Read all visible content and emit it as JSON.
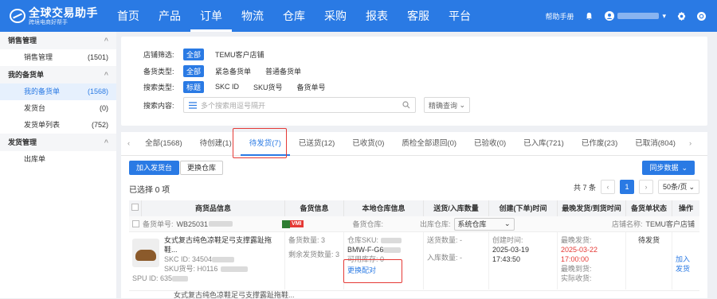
{
  "app": {
    "logo_title": "全球交易助手",
    "logo_sub": "跨境电商好帮手"
  },
  "nav": [
    "首页",
    "产品",
    "订单",
    "物流",
    "仓库",
    "采购",
    "报表",
    "客服",
    "平台"
  ],
  "nav_active": 2,
  "topright": {
    "help": "帮助手册"
  },
  "colors": {
    "primary": "#2a7ae4",
    "alert": "#e53935",
    "vmi_green": "#2e7d32"
  },
  "sidebar": {
    "groups": [
      {
        "label": "销售管理",
        "items": [
          {
            "label": "销售管理",
            "count": "(1501)"
          }
        ]
      },
      {
        "label": "我的备货单",
        "items": [
          {
            "label": "我的备货单",
            "count": "(1568)",
            "active": true
          },
          {
            "label": "发货台",
            "count": "(0)"
          },
          {
            "label": "发货单列表",
            "count": "(752)"
          }
        ]
      },
      {
        "label": "发货管理",
        "items": [
          {
            "label": "出库单",
            "count": ""
          }
        ]
      }
    ]
  },
  "filters": {
    "shop": {
      "label": "店铺筛选:",
      "options": [
        "全部",
        "TEMU客户店铺"
      ]
    },
    "stock_type": {
      "label": "备货类型:",
      "options": [
        "全部",
        "紧急备货单",
        "普通备货单"
      ]
    },
    "search_type": {
      "label": "搜索类型:",
      "options": [
        "标题",
        "SKC ID",
        "SKU货号",
        "备货单号"
      ]
    },
    "search": {
      "label": "搜索内容:",
      "placeholder": "多个搜索用逗号隔开",
      "mode": "精确查询"
    }
  },
  "tabs": [
    "全部(1568)",
    "待创建(1)",
    "待发货(7)",
    "已送货(12)",
    "已收货(0)",
    "质检全部退回(0)",
    "已验收(0)",
    "已入库(721)",
    "已作废(23)",
    "已取消(804)"
  ],
  "tab_active": 2,
  "actions": {
    "add_to_shipping": "加入发货台",
    "change_warehouse": "更换仓库",
    "sync": "同步数据"
  },
  "selection": "已选择 0 项",
  "pager": {
    "total": "共 7 条",
    "current": "1",
    "per_page": "50条/页"
  },
  "columns": [
    "商货品信息",
    "备货信息",
    "本地仓库信息",
    "送货/入库数量",
    "创建(下单)时间",
    "最晚发货/到货时间",
    "备货单状态",
    "操作"
  ],
  "order": {
    "order_no_label": "备货单号:",
    "order_no": "WB25031",
    "badge": "VMI",
    "warehouse_label": "备货仓库:",
    "outbound_label": "出库仓库:",
    "outbound_value": "系统仓库",
    "shop_label": "店铺名称:",
    "shop_value": "TEMU客户店铺",
    "title": "女式复古纯色凉鞋足弓支撑露趾拖鞋...",
    "skc_label": "SKC ID:",
    "skc": "34504",
    "sku_label": "SKU货号:",
    "sku": "H0116",
    "spu_label": "SPU ID:",
    "spu": "635",
    "stock_qty": "备货数量: 3",
    "remain_qty": "剩余发货数量: 3",
    "wh_sku_label": "仓库SKU:",
    "wh_sku": "BMW-F-G6",
    "avail_stock": "可用库存: 0",
    "change_match": "更换配对",
    "sent_qty": "送货数量: -",
    "in_qty": "入库数量: -",
    "created_label": "创建时间:",
    "created": "2025-03-19 17:43:50",
    "latest_ship_label": "最晚发货:",
    "latest_ship": "2025-03-22 17:00:00",
    "latest_arrive": "最晚到货:",
    "actual_receive": "实际收货:",
    "status": "待发货",
    "op": "加入发货"
  },
  "next_title": "女式复古纯色凉鞋足弓支撑露趾拖鞋..."
}
